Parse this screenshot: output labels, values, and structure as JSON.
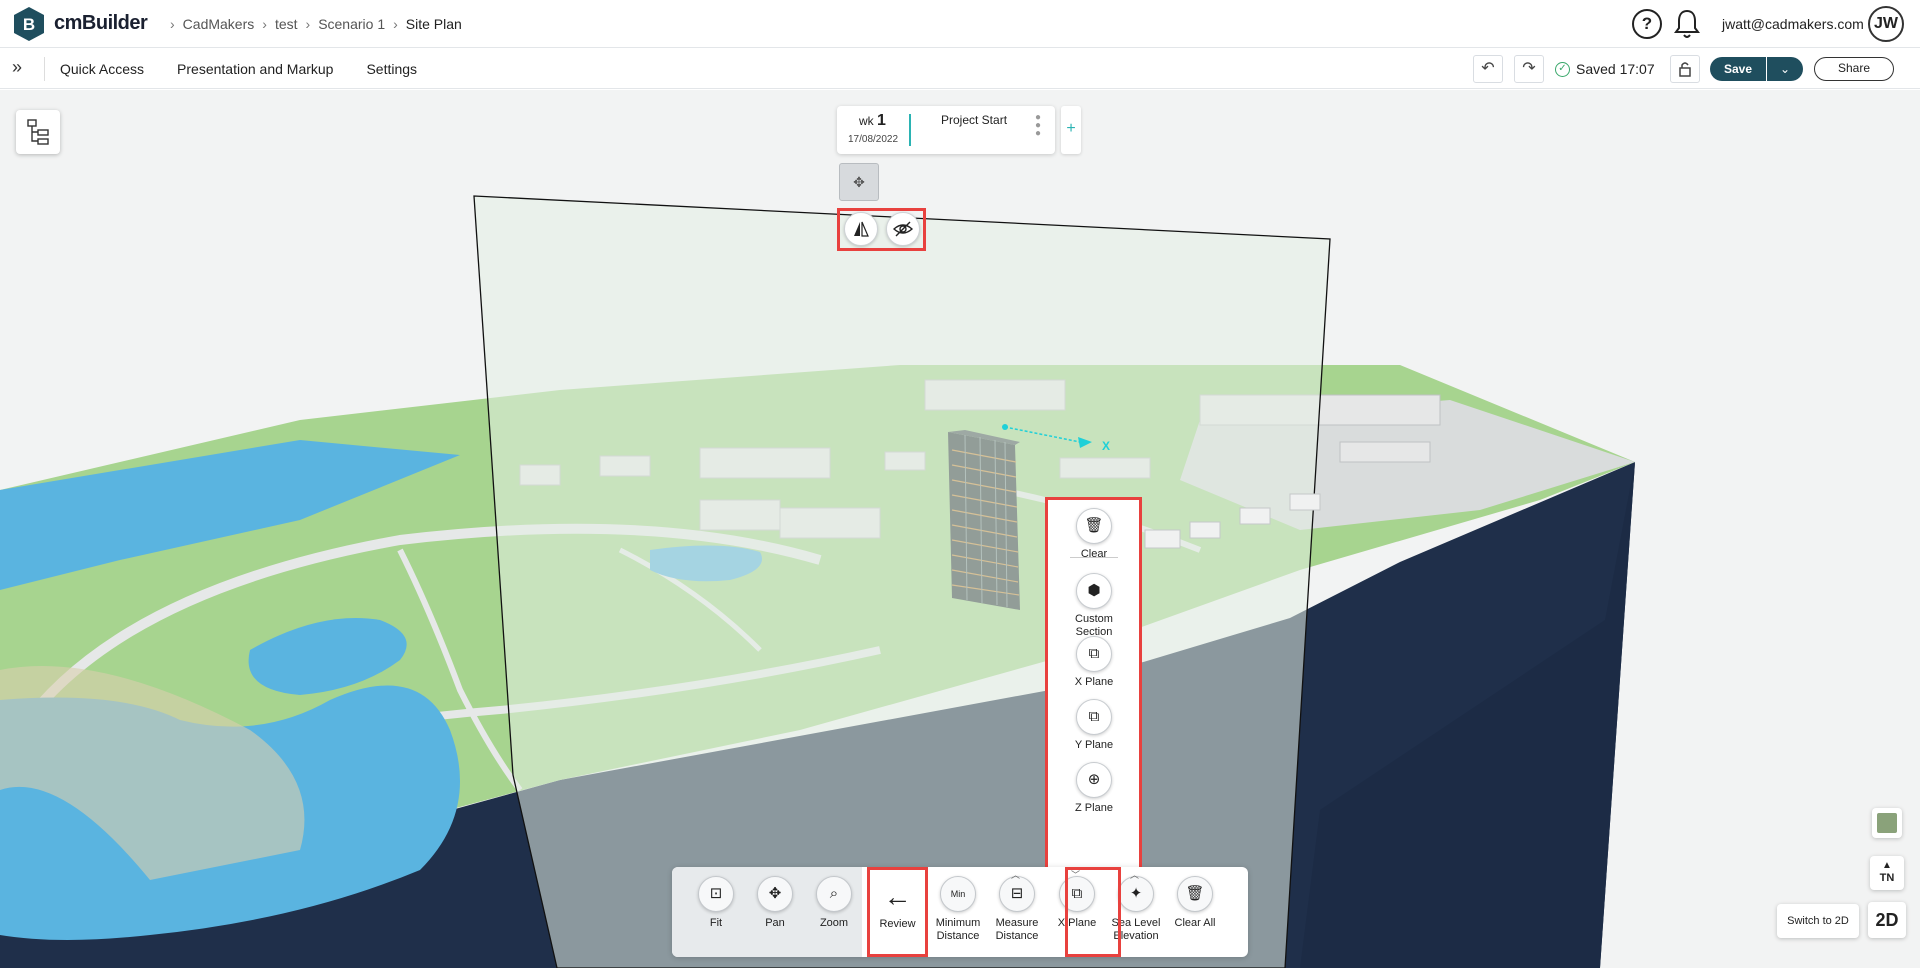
{
  "app": {
    "brand": "cmBuilder",
    "logo_letter": "B"
  },
  "breadcrumbs": [
    "CadMakers",
    "test",
    "Scenario 1",
    "Site Plan"
  ],
  "header": {
    "help_label": "?",
    "user_email": "jwatt@cadmakers.com",
    "user_initials": "JW"
  },
  "menubar": {
    "items": [
      "Quick Access",
      "Presentation and Markup",
      "Settings"
    ],
    "saved_text": "Saved 17:07",
    "save_label": "Save",
    "share_label": "Share"
  },
  "timeline": {
    "wk_label": "wk",
    "wk_number": "1",
    "date": "17/08/2022",
    "title": "Project Start",
    "add_label": "+"
  },
  "scene": {
    "axis_label": "X"
  },
  "section_tools": [
    {
      "label": "Clear",
      "icon": "trash-icon"
    },
    {
      "label": "Custom Section",
      "icon": "custom-section-icon"
    },
    {
      "label": "X Plane",
      "icon": "x-plane-icon"
    },
    {
      "label": "Y Plane",
      "icon": "y-plane-icon"
    },
    {
      "label": "Z Plane",
      "icon": "z-plane-icon"
    }
  ],
  "toolbar": {
    "nav": [
      {
        "label": "Fit",
        "icon": "fit-icon"
      },
      {
        "label": "Pan",
        "icon": "pan-icon"
      },
      {
        "label": "Zoom",
        "icon": "zoom-icon"
      }
    ],
    "review_label": "Review",
    "measure": [
      {
        "label": "Minimum Distance",
        "icon": "minimum-distance-icon"
      },
      {
        "label": "Measure Distance",
        "icon": "measure-distance-icon"
      },
      {
        "label": "X Plane",
        "icon": "x-plane-icon"
      },
      {
        "label": "Sea Level Elevation",
        "icon": "sea-level-icon"
      },
      {
        "label": "Clear All",
        "icon": "trash-icon"
      }
    ]
  },
  "right_controls": {
    "north_label": "TN",
    "switch_label": "Switch to 2D",
    "mode_label": "2D"
  },
  "colors": {
    "accent": "#1f4e5e",
    "teal": "#2bb3b3",
    "highlight": "#e8413e",
    "water": "#5ab4e0",
    "grass": "#a3d18c",
    "ground": "#1f2f4a"
  }
}
